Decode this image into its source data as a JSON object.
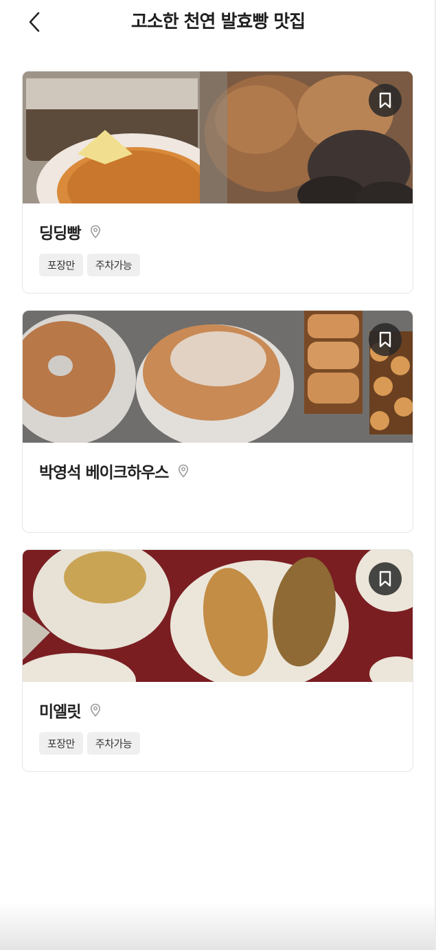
{
  "header": {
    "title": "고소한 천연 발효빵 맛집",
    "back_icon": "chevron-left-icon"
  },
  "cards": [
    {
      "name": "딩딩빵",
      "tags": [
        "포장만",
        "주차가능"
      ],
      "bookmark_icon": "bookmark-icon",
      "location_icon": "map-pin-icon"
    },
    {
      "name": "박영석 베이크하우스",
      "tags": [],
      "bookmark_icon": "bookmark-icon",
      "location_icon": "map-pin-icon"
    },
    {
      "name": "미엘릿",
      "tags": [
        "포장만",
        "주차가능"
      ],
      "bookmark_icon": "bookmark-icon",
      "location_icon": "map-pin-icon"
    }
  ],
  "colors": {
    "tag_bg": "#efefef",
    "bookmark_bg": "#282828",
    "text_primary": "#222222",
    "card_border": "#e6e6e6"
  }
}
